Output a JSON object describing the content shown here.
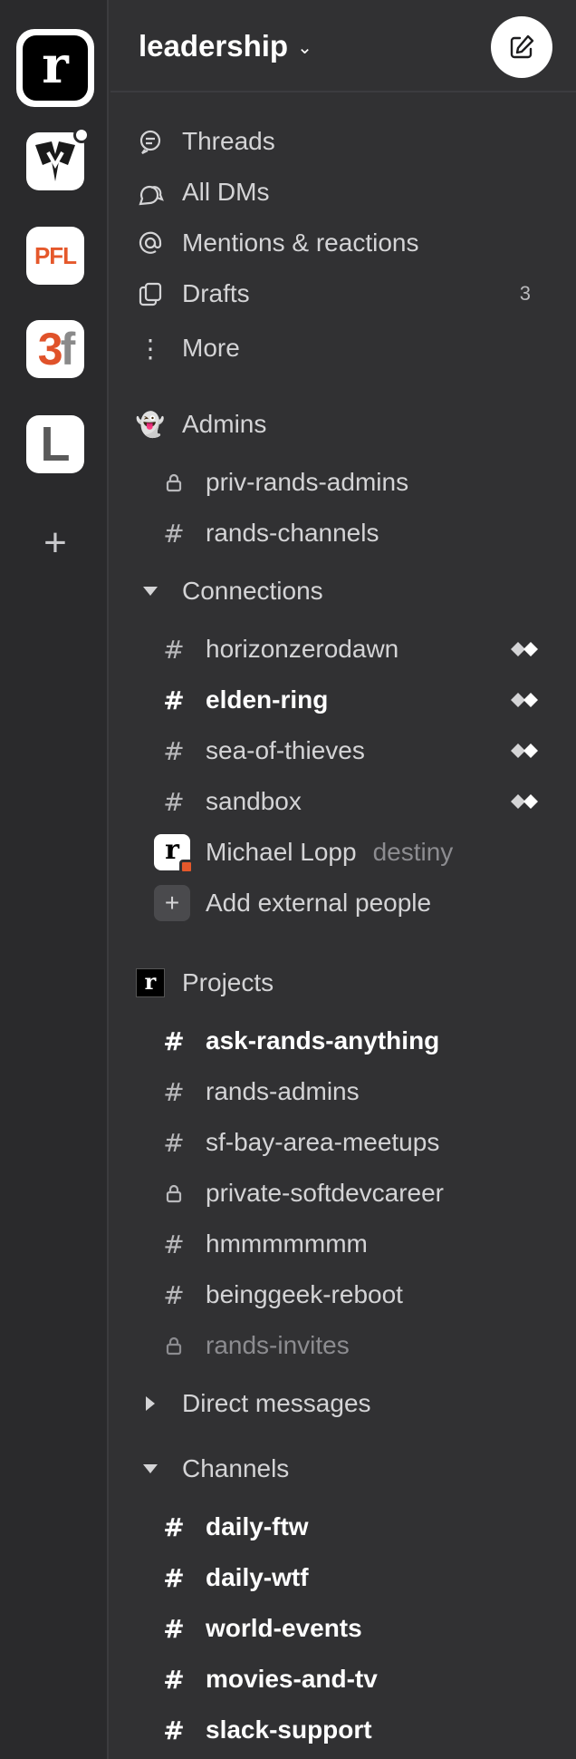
{
  "workspaces": [
    {
      "name": "rands",
      "glyph": "r",
      "selected": true
    },
    {
      "name": "destiny",
      "glyph": "",
      "unread": true
    },
    {
      "name": "PFL",
      "glyph": "PFL"
    },
    {
      "name": "3f",
      "glyph_a": "3",
      "glyph_b": "f"
    },
    {
      "name": "L",
      "glyph": "L"
    }
  ],
  "add_workspace_icon": "+",
  "header": {
    "workspace_name": "leadership",
    "chevron": "⌄"
  },
  "top_nav": [
    {
      "label": "Threads",
      "icon": "threads-icon"
    },
    {
      "label": "All DMs",
      "icon": "dms-icon"
    },
    {
      "label": "Mentions & reactions",
      "icon": "at-icon"
    },
    {
      "label": "Drafts",
      "icon": "drafts-icon",
      "badge": "3"
    },
    {
      "label": "More",
      "icon": "more-icon"
    }
  ],
  "sections": {
    "admins": {
      "title": "Admins",
      "emoji": "👻",
      "channels": [
        {
          "name": "priv-rands-admins",
          "private": true
        },
        {
          "name": "rands-channels",
          "private": false
        }
      ]
    },
    "connections": {
      "title": "Connections",
      "channels": [
        {
          "name": "horizonzerodawn",
          "shared": true
        },
        {
          "name": "elden-ring",
          "shared": true,
          "unread": true
        },
        {
          "name": "sea-of-thieves",
          "shared": true
        },
        {
          "name": "sandbox",
          "shared": true
        }
      ],
      "dm": {
        "name": "Michael Lopp",
        "secondary": "destiny",
        "avatar_glyph": "r"
      },
      "add_people": "Add external people",
      "add_icon": "+"
    },
    "projects": {
      "title": "Projects",
      "logo_glyph": "r",
      "channels": [
        {
          "name": "ask-rands-anything",
          "unread": true
        },
        {
          "name": "rands-admins"
        },
        {
          "name": "sf-bay-area-meetups"
        },
        {
          "name": "private-softdevcareer",
          "private": true
        },
        {
          "name": "hmmmmmmm"
        },
        {
          "name": "beinggeek-reboot"
        },
        {
          "name": "rands-invites",
          "private": true,
          "muted": true
        }
      ]
    },
    "direct_messages": {
      "title": "Direct messages"
    },
    "channels": {
      "title": "Channels",
      "channels": [
        {
          "name": "daily-ftw"
        },
        {
          "name": "daily-wtf"
        },
        {
          "name": "world-events"
        },
        {
          "name": "movies-and-tv"
        },
        {
          "name": "slack-support"
        }
      ]
    }
  },
  "glyphs": {
    "hash": "#",
    "kebab": "⋮"
  },
  "colors": {
    "background": "#313133",
    "rail": "#2a2a2c",
    "text": "#d4d4d6",
    "accent_orange": "#e5582b"
  }
}
